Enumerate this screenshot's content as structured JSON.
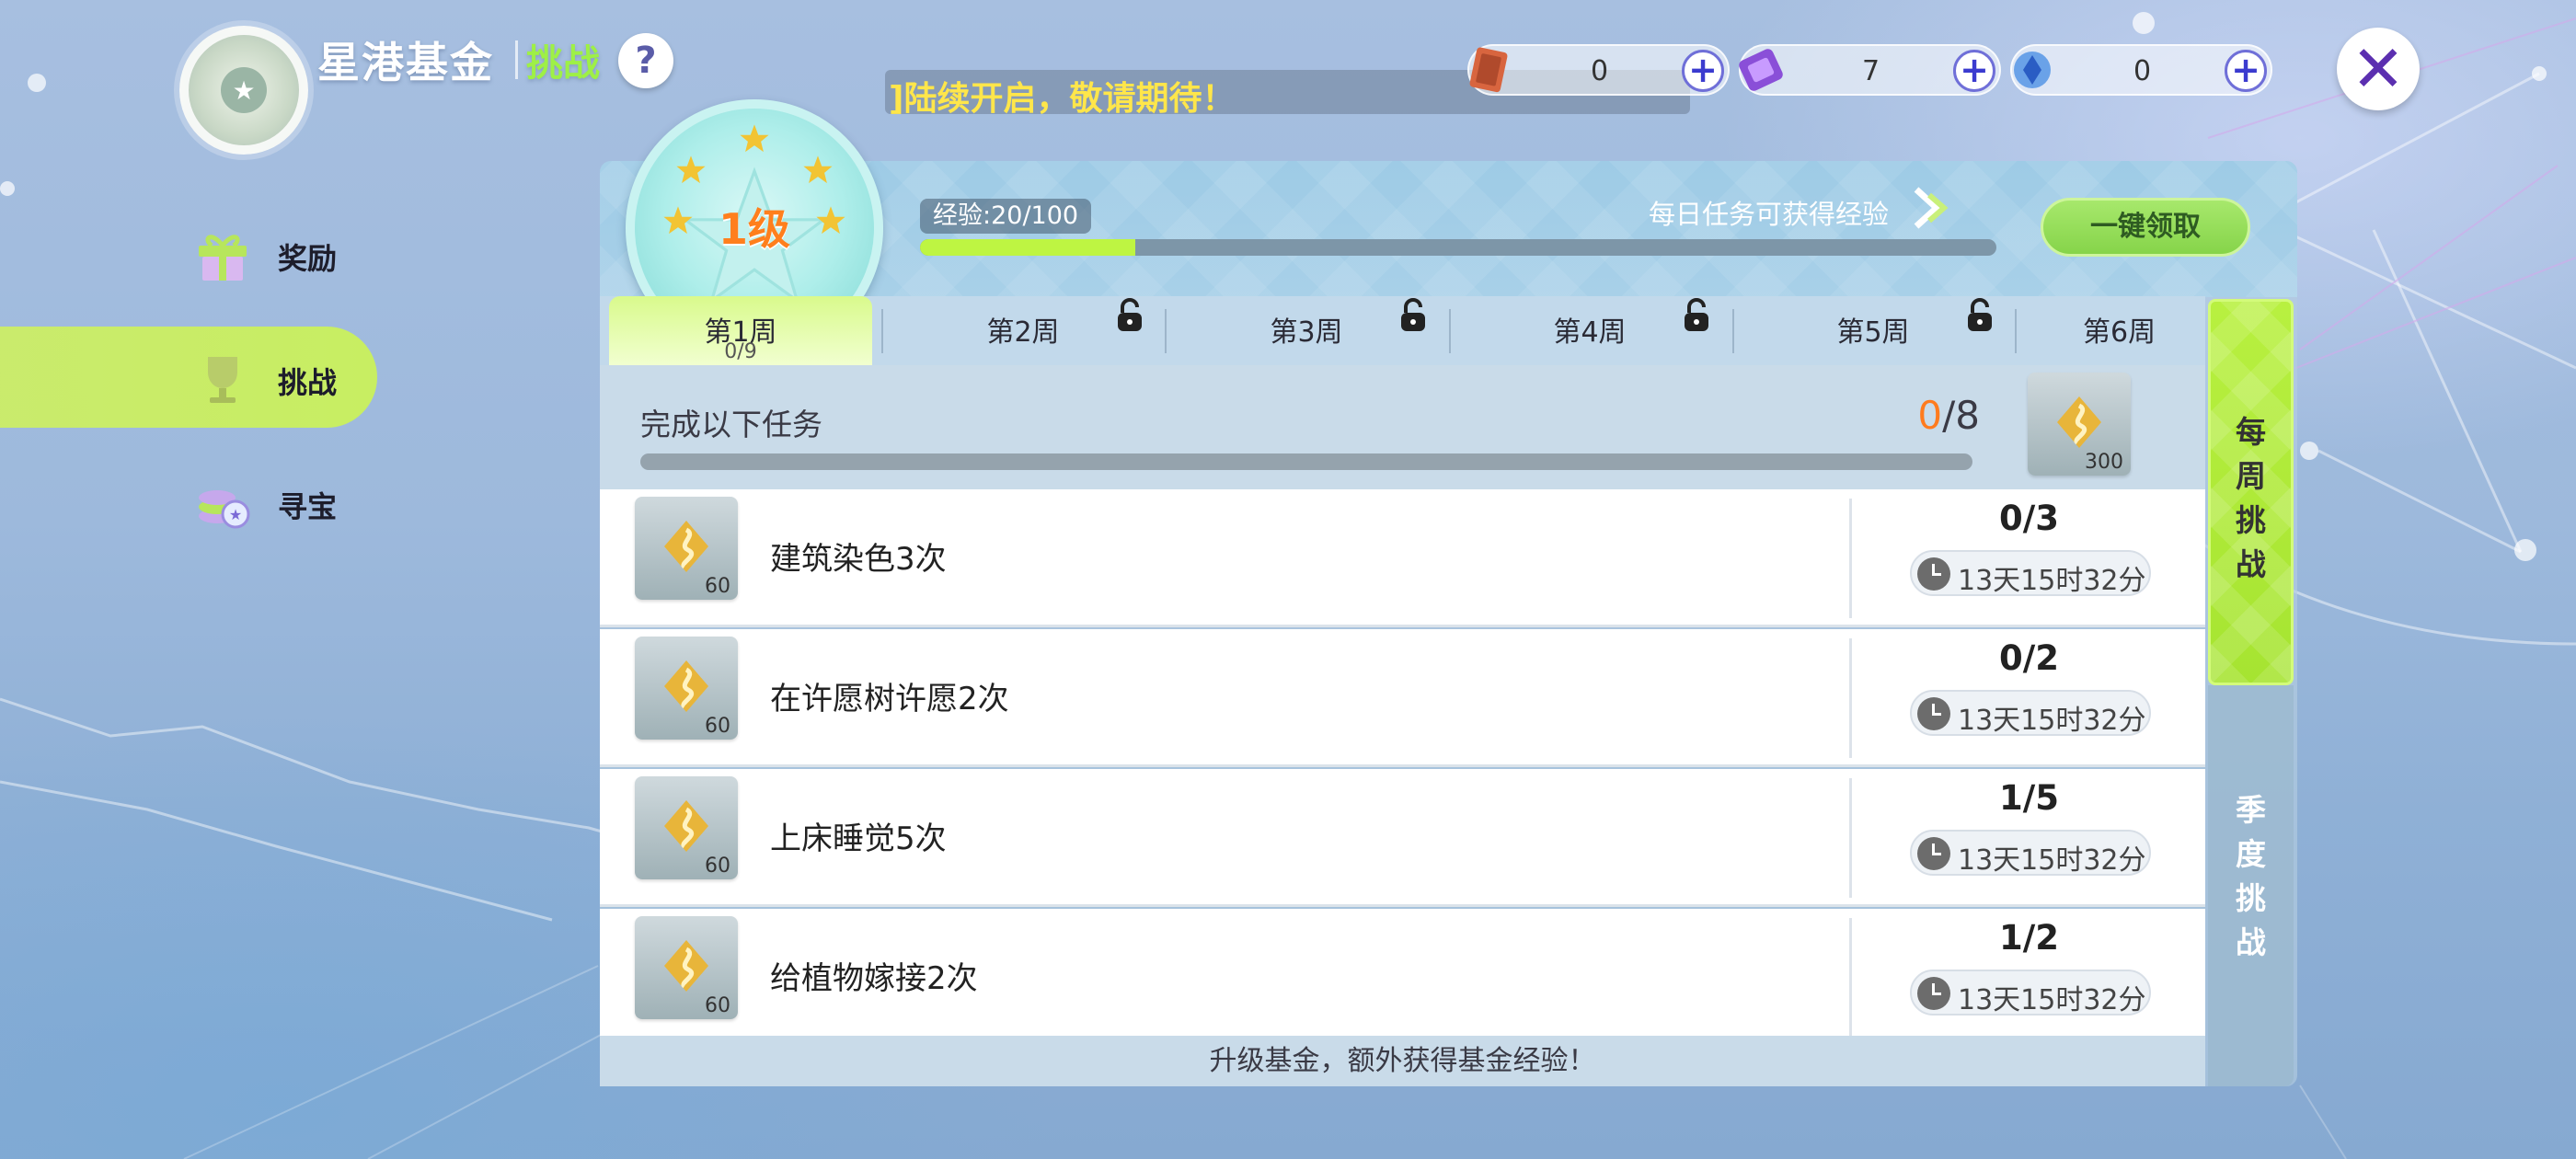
{
  "header": {
    "title": "星港基金",
    "subtitle": "挑战",
    "help": "?",
    "ticker": "]陆续开启，敬请期待！",
    "close": "✕"
  },
  "currencies": [
    {
      "icon": "red-card-icon",
      "value": "0",
      "plus": "+"
    },
    {
      "icon": "purple-ticket-icon",
      "value": "7",
      "plus": "+"
    },
    {
      "icon": "blue-gem-icon",
      "value": "0",
      "plus": "+"
    }
  ],
  "nav": [
    {
      "label": "奖励",
      "icon": "gift-icon",
      "active": false
    },
    {
      "label": "挑战",
      "icon": "trophy-icon",
      "active": true
    },
    {
      "label": "寻宝",
      "icon": "coins-icon",
      "active": false
    }
  ],
  "level": {
    "label": "1级",
    "exp_label": "经验:20/100",
    "exp_progress": 0.2,
    "daily_tip": "每日任务可获得经验",
    "claim_all": "一键领取"
  },
  "weeks": [
    {
      "label": "第1周",
      "sub": "0/9",
      "locked": false,
      "active": true
    },
    {
      "label": "第2周",
      "sub": "",
      "locked": true,
      "active": false
    },
    {
      "label": "第3周",
      "sub": "",
      "locked": true,
      "active": false
    },
    {
      "label": "第4周",
      "sub": "",
      "locked": true,
      "active": false
    },
    {
      "label": "第5周",
      "sub": "",
      "locked": true,
      "active": false
    },
    {
      "label": "第6周",
      "sub": "",
      "locked": false,
      "active": false
    }
  ],
  "task_header": {
    "label": "完成以下任务",
    "current": "0",
    "total": "/8",
    "reward": "300"
  },
  "tasks": [
    {
      "reward": "60",
      "name": "建筑染色3次",
      "progress": "0/3",
      "timer": "13天15时32分"
    },
    {
      "reward": "60",
      "name": "在许愿树许愿2次",
      "progress": "0/2",
      "timer": "13天15时32分"
    },
    {
      "reward": "60",
      "name": "上床睡觉5次",
      "progress": "1/5",
      "timer": "13天15时32分"
    },
    {
      "reward": "60",
      "name": "给植物嫁接2次",
      "progress": "1/2",
      "timer": "13天15时32分"
    }
  ],
  "footer": "升级基金，额外获得基金经验！",
  "side_tabs": [
    {
      "label": "每\n周\n挑\n战",
      "active": true
    },
    {
      "label": "季\n度\n挑\n战",
      "active": false
    }
  ],
  "colors": {
    "accent_green": "#bef542",
    "progress_orange": "#ff7b1e",
    "ticker_yellow": "#ffe64a",
    "title_green": "#9ef046"
  }
}
